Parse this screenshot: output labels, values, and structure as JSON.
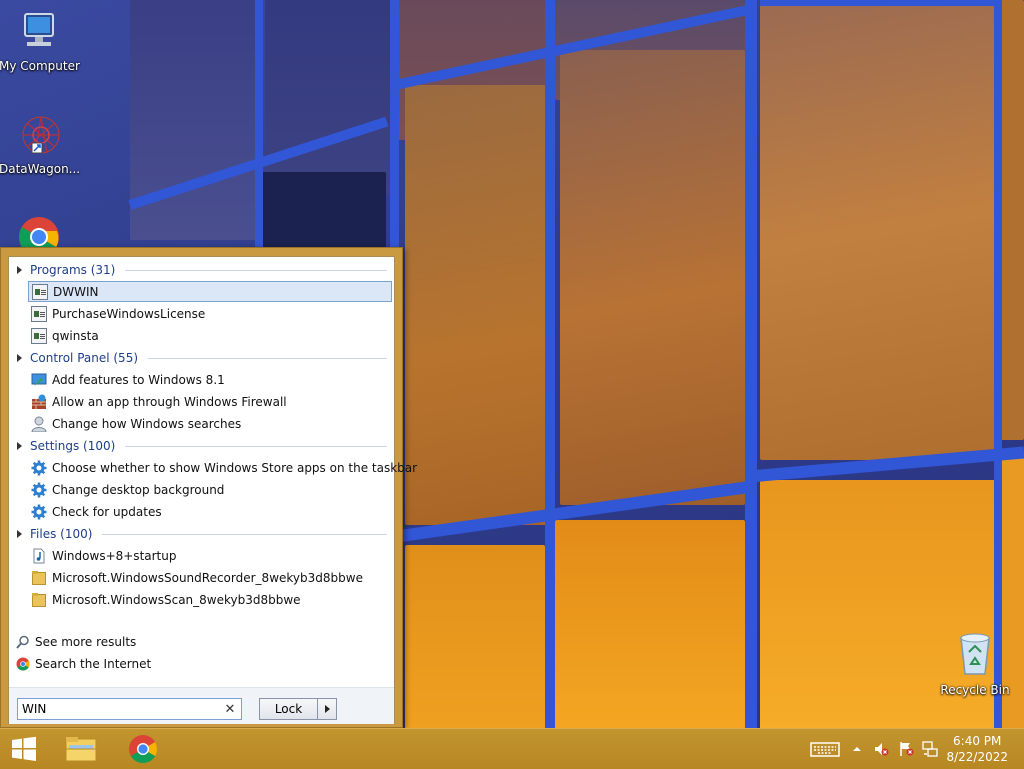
{
  "desktop": {
    "icons": [
      {
        "label": "My Computer",
        "icon": "computer-icon"
      },
      {
        "label": "DataWagon...",
        "icon": "datawagon-icon"
      },
      {
        "label": "",
        "icon": "chrome-icon"
      },
      {
        "label": "Recycle Bin",
        "icon": "recycle-bin-icon"
      }
    ]
  },
  "start_menu": {
    "groups": [
      {
        "header": "Programs (31)",
        "items": [
          {
            "label": "DWWIN",
            "icon": "program-icon",
            "selected": true
          },
          {
            "label": "PurchaseWindowsLicense",
            "icon": "program-icon"
          },
          {
            "label": "qwinsta",
            "icon": "program-icon"
          }
        ]
      },
      {
        "header": "Control Panel (55)",
        "items": [
          {
            "label": "Add features to Windows 8.1",
            "icon": "add-features-icon"
          },
          {
            "label": "Allow an app through Windows Firewall",
            "icon": "firewall-icon"
          },
          {
            "label": "Change how Windows searches",
            "icon": "user-search-icon"
          }
        ]
      },
      {
        "header": "Settings (100)",
        "items": [
          {
            "label": "Choose whether to show Windows Store apps on the taskbar",
            "icon": "gear-icon"
          },
          {
            "label": "Change desktop background",
            "icon": "gear-icon"
          },
          {
            "label": "Check for updates",
            "icon": "gear-icon"
          }
        ]
      },
      {
        "header": "Files (100)",
        "items": [
          {
            "label": "Windows+8+startup",
            "icon": "audio-file-icon"
          },
          {
            "label": "Microsoft.WindowsSoundRecorder_8wekyb3d8bbwe",
            "icon": "folder-icon"
          },
          {
            "label": "Microsoft.WindowsScan_8wekyb3d8bbwe",
            "icon": "folder-icon"
          }
        ]
      }
    ],
    "see_more": "See more results",
    "search_internet": "Search the Internet",
    "search_value": "WIN",
    "lock_label": "Lock"
  },
  "taskbar": {
    "clock_time": "6:40 PM",
    "clock_date": "8/22/2022"
  }
}
